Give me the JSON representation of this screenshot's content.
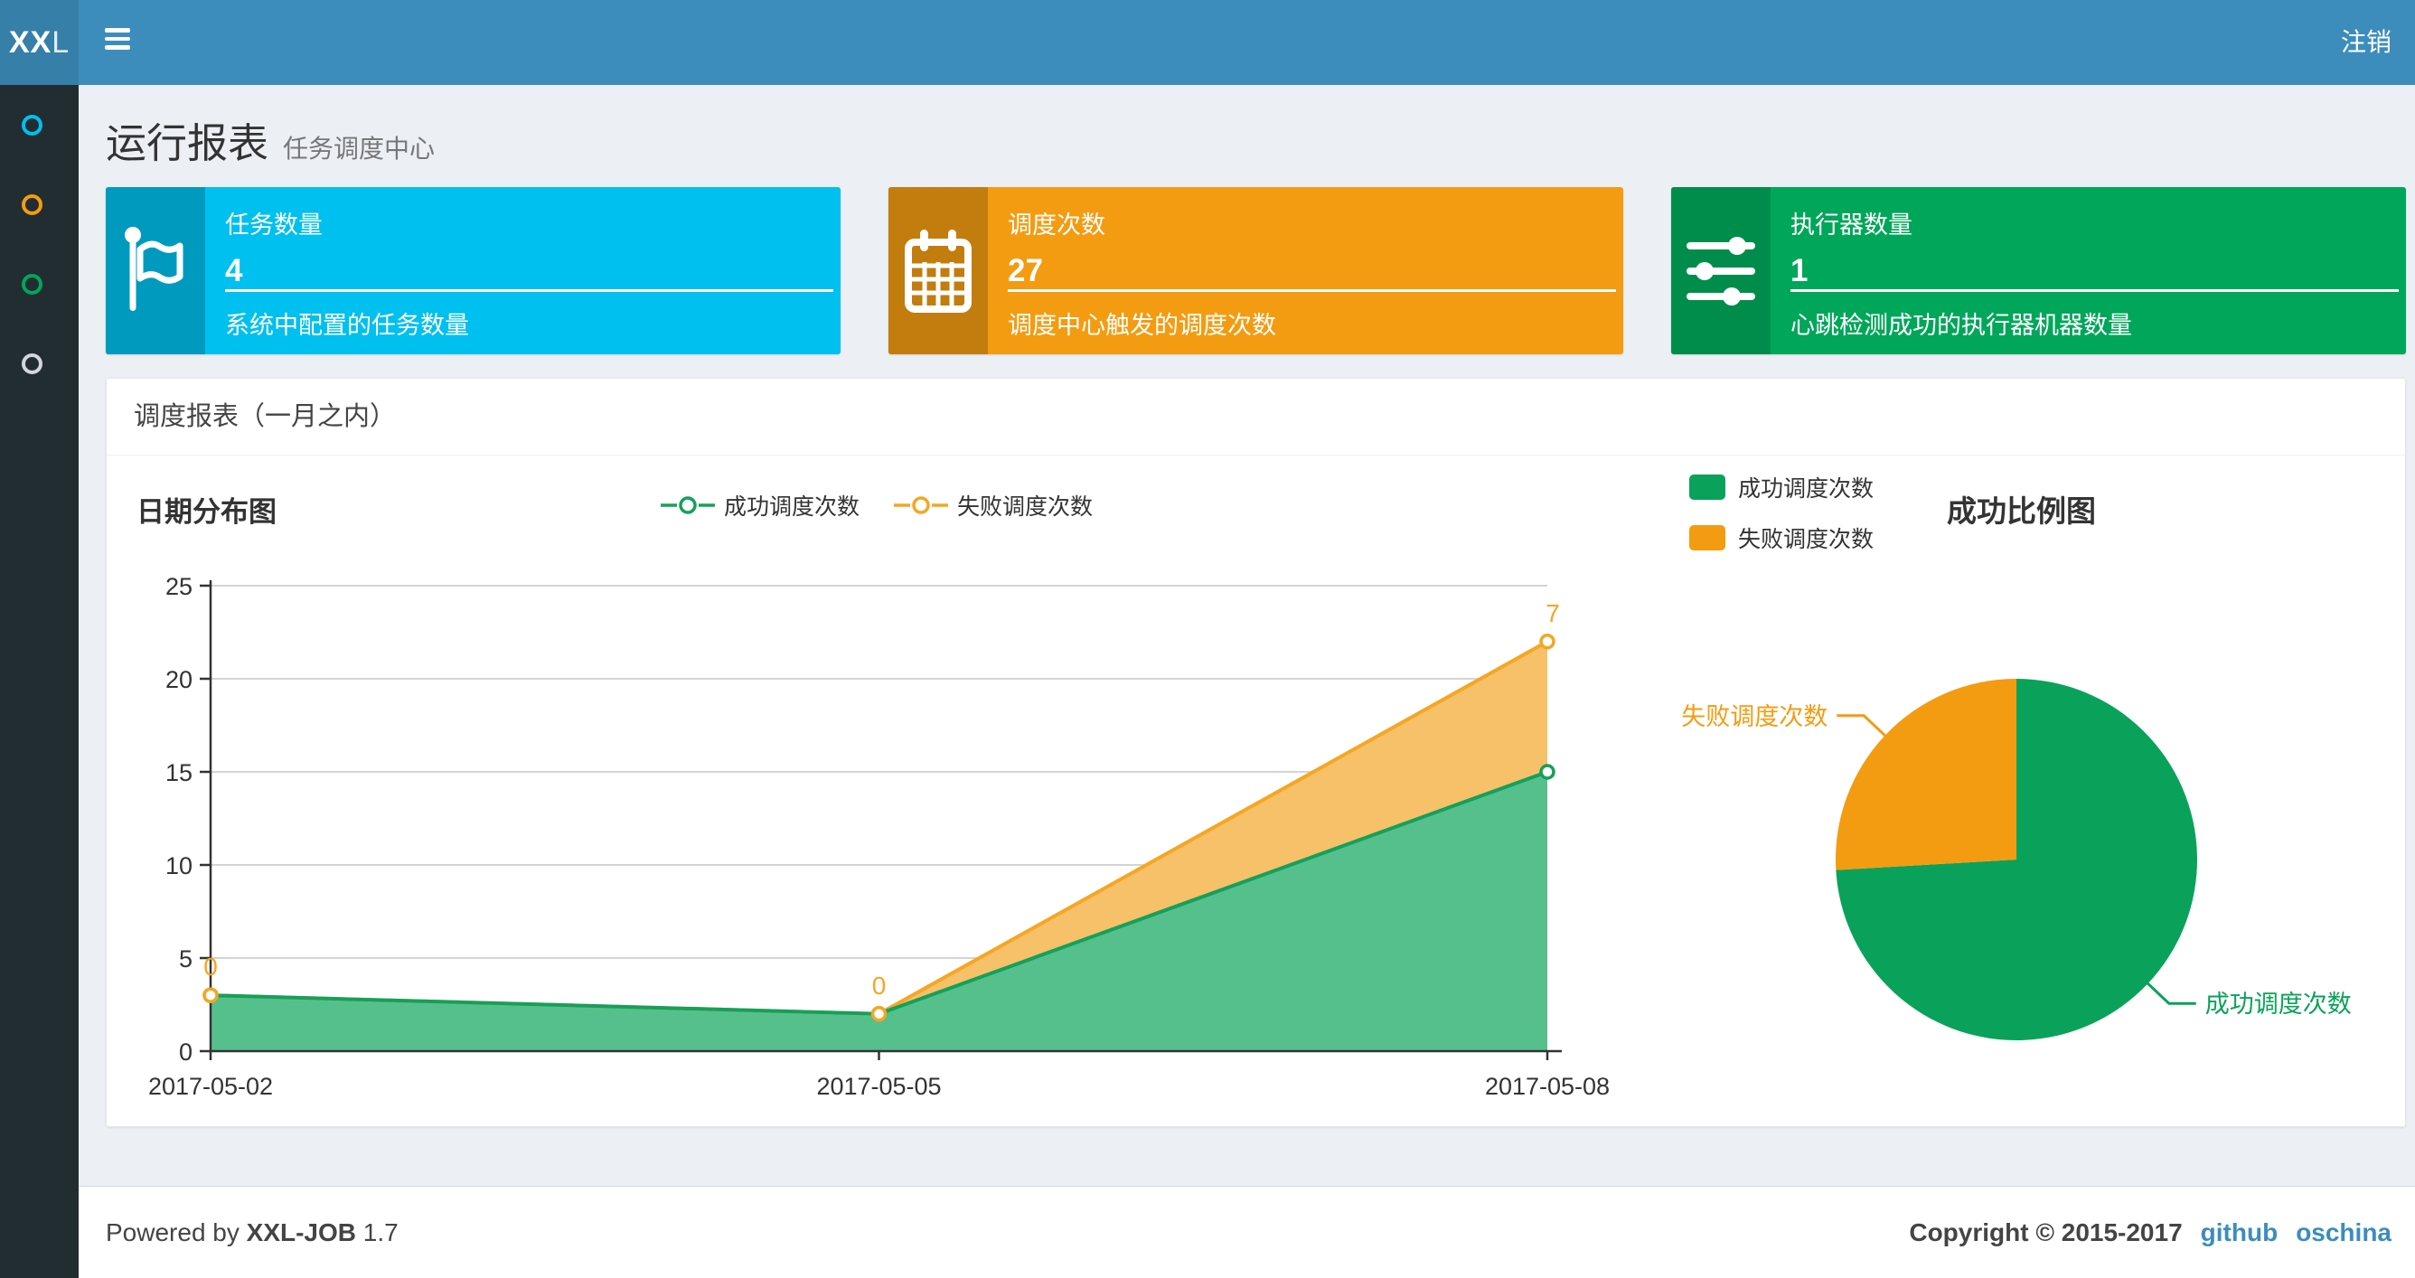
{
  "navbar": {
    "logo_bold": "XX",
    "logo_light": "L",
    "logout_label": "注销"
  },
  "sidebar": {
    "items": [
      {
        "icon": "circle-o-icon",
        "color": "#00c0ef",
        "active": true
      },
      {
        "icon": "circle-o-icon",
        "color": "#f39c12",
        "active": false
      },
      {
        "icon": "circle-o-icon",
        "color": "#00a65a",
        "active": false
      },
      {
        "icon": "circle-o-icon",
        "color": "#d2d6de",
        "active": false
      }
    ]
  },
  "page_header": {
    "title": "运行报表",
    "subtitle": "任务调度中心"
  },
  "info_boxes": [
    {
      "label": "任务数量",
      "value": "4",
      "description": "系统中配置的任务数量",
      "color": "#00c0ef",
      "icon_bg": "#009abf",
      "icon": "flag-icon"
    },
    {
      "label": "调度次数",
      "value": "27",
      "description": "调度中心触发的调度次数",
      "color": "#f39c12",
      "icon_bg": "#c27d0e",
      "icon": "calendar-icon"
    },
    {
      "label": "执行器数量",
      "value": "1",
      "description": "心跳检测成功的执行器机器数量",
      "color": "#00a65a",
      "icon_bg": "#008d4c",
      "icon": "sliders-icon"
    }
  ],
  "panel": {
    "title": "调度报表（一月之内）"
  },
  "chart_data": [
    {
      "type": "area",
      "title": "日期分布图",
      "x": [
        "2017-05-02",
        "2017-05-05",
        "2017-05-08"
      ],
      "stacked": true,
      "series": [
        {
          "name": "成功调度次数",
          "values": [
            3,
            2,
            15
          ],
          "line_color": "#15a05c",
          "fill_color": "#56c08d"
        },
        {
          "name": "失败调度次数",
          "values": [
            0,
            0,
            7
          ],
          "line_color": "#f5a623",
          "fill_color": "#f6c169",
          "point_labels": [
            0,
            0,
            7
          ],
          "label_color": "#f5a623"
        }
      ],
      "ylim": [
        0,
        25
      ],
      "yticks": [
        0,
        5,
        10,
        15,
        20,
        25
      ],
      "grid": true,
      "legend_position": "top-center"
    },
    {
      "type": "pie",
      "title": "成功比例图",
      "slices": [
        {
          "label": "成功调度次数",
          "value": 20,
          "color": "#0aa25a"
        },
        {
          "label": "失败调度次数",
          "value": 7,
          "color": "#f39c12"
        }
      ],
      "legend_position": "top-left"
    }
  ],
  "footer": {
    "powered_prefix": "Powered by ",
    "product": "XXL-JOB",
    "version": " 1.7",
    "copyright": "Copyright © 2015-2017",
    "links": [
      "github",
      "oschina"
    ]
  }
}
